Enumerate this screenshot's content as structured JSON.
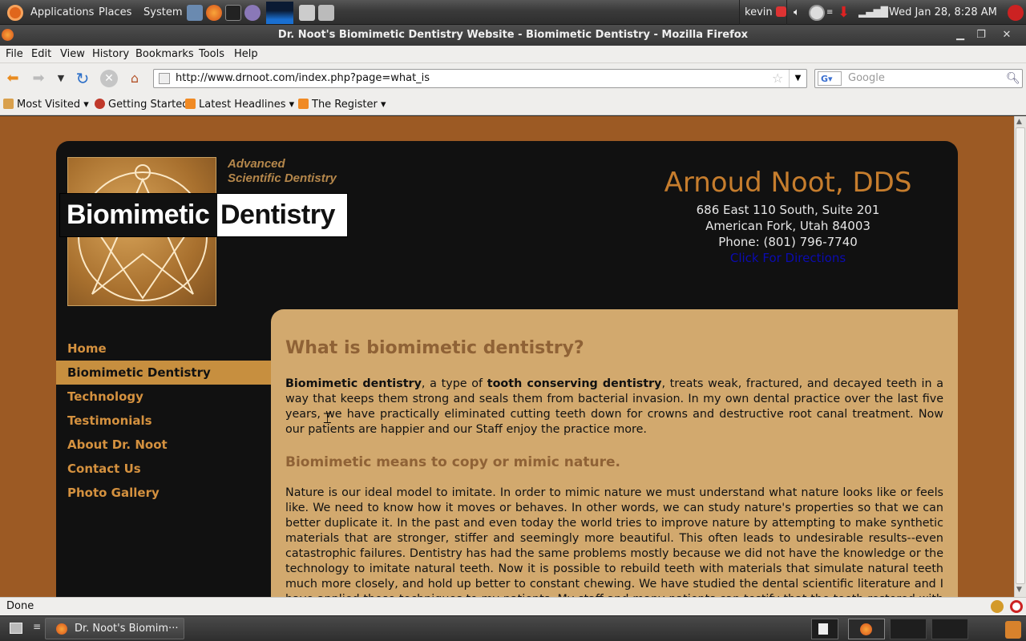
{
  "top_panel": {
    "menus": [
      "Applications",
      "Places",
      "System"
    ],
    "user": "kevin",
    "clock": "Wed Jan 28,  8:28 AM"
  },
  "window": {
    "title": "Dr. Noot's Biomimetic Dentistry Website - Biomimetic Dentistry - Mozilla Firefox"
  },
  "menubar": [
    "File",
    "Edit",
    "View",
    "History",
    "Bookmarks",
    "Tools",
    "Help"
  ],
  "navbar": {
    "url": "http://www.drnoot.com/index.php?page=what_is",
    "search_placeholder": "Google"
  },
  "bookmarks": [
    "Most Visited",
    "Getting Started",
    "Latest Headlines",
    "The Register"
  ],
  "site": {
    "logo": {
      "tagline_1": "Advanced",
      "tagline_2": "Scientific Dentistry",
      "word_1": "Biomimetic",
      "word_2": "Dentistry"
    },
    "contact": {
      "name": "Arnoud Noot, DDS",
      "address_1": "686 East 110 South, Suite 201",
      "address_2": "American Fork, Utah 84003",
      "phone": "Phone: (801) 796-7740",
      "directions": "Click For Directions"
    },
    "nav": [
      "Home",
      "Biomimetic Dentistry",
      "Technology",
      "Testimonials",
      "About Dr. Noot",
      "Contact Us",
      "Photo Gallery"
    ],
    "content": {
      "heading": "What is biomimetic dentistry?",
      "p1_term1": "Biomimetic dentistry",
      "p1_mid": ", a type of ",
      "p1_term2": "tooth conserving dentistry",
      "p1_rest": ", treats weak, fractured, and decayed teeth in a way that keeps them strong and seals them from bacterial invasion. In my own dental practice over the last five years, we have practically eliminated cutting teeth down for crowns and destructive root canal treatment. Now our patients are happier and our Staff enjoy the practice more.",
      "subheading": "Biomimetic means to copy or mimic nature.",
      "p2": "Nature is our ideal model to imitate. In order to mimic nature we must understand what nature looks like or feels like. We need to know how it moves or behaves. In other words, we can study nature's properties so that we can better duplicate it. In the past and even today the world tries to improve nature by attempting to make synthetic materials that are stronger, stiffer and seemingly more beautiful. This often leads to undesirable results--even catastrophic failures. Dentistry has had the same problems mostly because we did not have the knowledge or the technology to imitate natural teeth. Now it is possible to rebuild teeth with materials that simulate natural teeth much more closely, and hold up better to constant chewing. We have studied the dental scientific literature and I have applied those techniques to my patients. My staff and many patients can testify that the teeth restored with my biomimetic restorations feel and look much more natural."
    }
  },
  "statusbar": {
    "text": "Done"
  },
  "taskbar": {
    "task_label": "Dr. Noot's Biomim···"
  },
  "colors": {
    "page_bg": "#9c5a24",
    "site_bg": "#111111",
    "content_bg": "#d2a96e",
    "accent": "#c67d2d",
    "nav_active": "#c78f3f",
    "link": "#0b0bb0"
  }
}
